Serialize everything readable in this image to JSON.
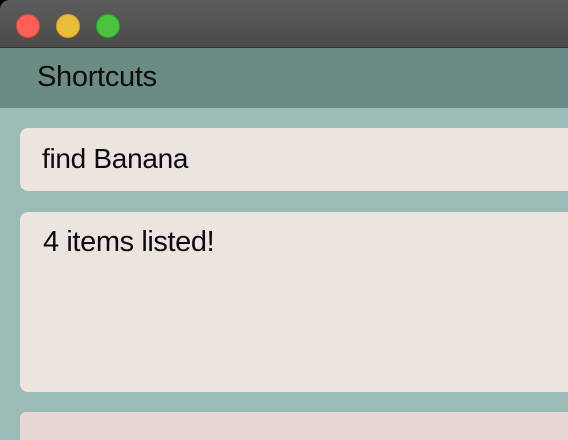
{
  "app": {
    "title": "Shortcuts"
  },
  "window_controls": {
    "close_color": "#fe5f57",
    "minimize_color": "#e8be3a",
    "zoom_color": "#4cc23d"
  },
  "command_box": {
    "value": "find Banana"
  },
  "result_display": {
    "text": "4 items listed!"
  },
  "colors": {
    "background": "#9bbcb6",
    "menubar": "#6a8c85",
    "card": "#ebe4df",
    "list_panel": "#e8d6d2"
  }
}
